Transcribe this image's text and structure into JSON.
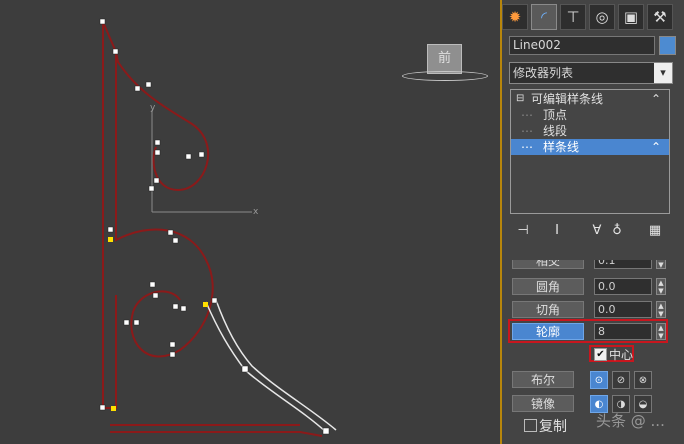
{
  "viewport": {
    "viewcube_label": "前",
    "axis_y": "y",
    "axis_x": "x"
  },
  "panel": {
    "tabs": [
      {
        "name": "create-tab",
        "icon": "sun-icon"
      },
      {
        "name": "modify-tab",
        "icon": "arc-icon"
      },
      {
        "name": "hierarchy-tab",
        "icon": "hierarchy-icon"
      },
      {
        "name": "motion-tab",
        "icon": "motion-icon"
      },
      {
        "name": "display-tab",
        "icon": "display-icon"
      },
      {
        "name": "utilities-tab",
        "icon": "hammer-icon"
      }
    ],
    "object_name": "Line002",
    "object_color": "#4d8bd1",
    "modifier_list": "修改器列表",
    "stack": {
      "root": "可编辑样条线",
      "items": [
        "顶点",
        "线段",
        "样条线"
      ],
      "selected": "样条线"
    }
  },
  "rollout": {
    "partial_label": "相交",
    "partial_value": "0.1",
    "fillet_label": "圆角",
    "fillet_value": "0.0",
    "chamfer_label": "切角",
    "chamfer_value": "0.0",
    "outline_label": "轮廓",
    "outline_value": "8",
    "center_label": "中心",
    "center_checked": "✔",
    "boolean_label": "布尔",
    "mirror_label": "镜像",
    "copy_label": "复制"
  },
  "watermark": "头条 @ ..."
}
